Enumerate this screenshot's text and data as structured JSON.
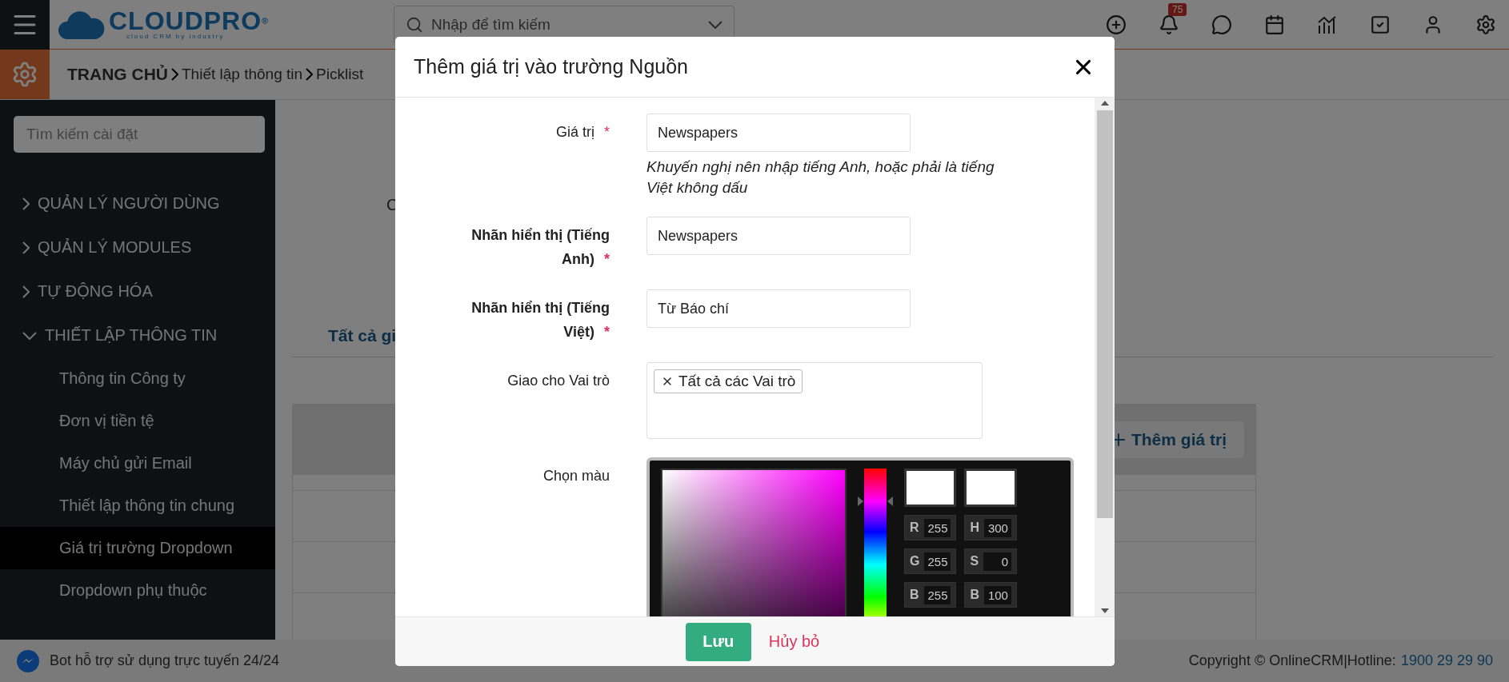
{
  "header": {
    "logo": {
      "name": "CLOUDPRO",
      "mark": "®",
      "tagline": "cloud CRM by industry"
    },
    "search": {
      "placeholder": "Nhập để tìm kiếm"
    },
    "notification_count": "75"
  },
  "breadcrumb": [
    "TRANG CHỦ",
    "Thiết lập thông tin",
    "Picklist"
  ],
  "sidebar": {
    "search": {
      "placeholder": "Tìm kiếm cài đặt"
    },
    "items": [
      {
        "label": "QUẢN LÝ NGƯỜI DÙNG",
        "expanded": false
      },
      {
        "label": "QUẢN LÝ MODULES",
        "expanded": false
      },
      {
        "label": "TỰ ĐỘNG HÓA",
        "expanded": false
      },
      {
        "label": "THIẾT LẬP THÔNG TIN",
        "expanded": true,
        "children": [
          {
            "label": "Thông tin Công ty",
            "selected": false
          },
          {
            "label": "Đơn vị tiền tệ",
            "selected": false
          },
          {
            "label": "Máy chủ gửi Email",
            "selected": false
          },
          {
            "label": "Thiết lập thông tin chung",
            "selected": false
          },
          {
            "label": "Giá trị trường Dropdown",
            "selected": true
          },
          {
            "label": "Dropdown phụ thuộc",
            "selected": false
          }
        ]
      }
    ]
  },
  "main": {
    "partial_label": "C",
    "tab": "Tất cả gi",
    "add_button": "Thêm giá trị"
  },
  "modal": {
    "title": "Thêm giá trị vào trường Nguồn",
    "fields": [
      {
        "kind": "text",
        "label": "Giá trị",
        "bold": false,
        "required_mark": "*",
        "value": "Newspapers",
        "hint": "Khuyến nghị nên nhập tiếng Anh, hoặc phải là tiếng Việt không dấu"
      },
      {
        "kind": "text",
        "label": "Nhãn hiển thị (Tiếng Anh)",
        "bold": true,
        "required_mark": "*",
        "value": "Newspapers"
      },
      {
        "kind": "text",
        "label": "Nhãn hiển thị (Tiếng Việt)",
        "bold": true,
        "required_mark": "*",
        "value": "Từ Báo chí"
      },
      {
        "kind": "tags",
        "label": "Giao cho Vai trò",
        "bold": false,
        "tags": [
          "Tất cả các Vai trò"
        ]
      },
      {
        "kind": "color",
        "label": "Chọn màu",
        "bold": false,
        "hue_slider": {
          "level": 0.83
        },
        "channels": [
          {
            "label": "R",
            "value": "255"
          },
          {
            "label": "H",
            "value": "300"
          },
          {
            "label": "G",
            "value": "255"
          },
          {
            "label": "S",
            "value": "0"
          },
          {
            "label": "B",
            "value": "255"
          },
          {
            "label": "B",
            "value": "100"
          }
        ]
      }
    ],
    "save": "Lưu",
    "cancel": "Hủy bỏ"
  },
  "footer": {
    "chat": "Bot hỗ trợ sử dụng trực tuyến 24/24",
    "copyright": "Copyright © OnlineCRM|Hotline:",
    "hotline": "1900 29 29 90"
  }
}
